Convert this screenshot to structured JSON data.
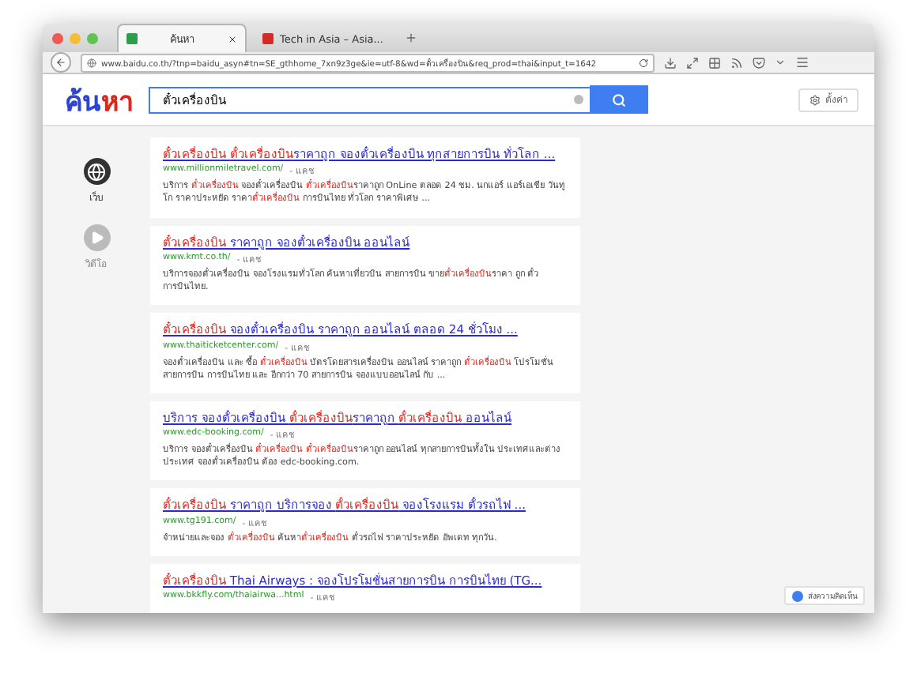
{
  "tabs": [
    {
      "label": "ค้นหา",
      "selected": true
    },
    {
      "label": "Tech in Asia – Asia...",
      "selected": false
    }
  ],
  "address": "www.baidu.co.th/?tnp=baidu_asyn#tn=SE_gthhome_7xn9z3ge&ie=utf-8&wd=ตั๋วเครื่องบิน&req_prod=thai&input_t=1642",
  "logo": [
    {
      "text": "ค้น",
      "color": "#2b44d6"
    },
    {
      "text": "หา",
      "color": "#e0261b"
    }
  ],
  "search": {
    "value": "ตั๋วเครื่องบิน"
  },
  "settings_button": "ตั้งค่า",
  "sidebar": {
    "items": [
      {
        "label": "เว็บ",
        "kind": "globe",
        "selected": true
      },
      {
        "label": "วิดีโอ",
        "kind": "video",
        "selected": false
      }
    ]
  },
  "results": [
    {
      "title": [
        {
          "text": "ตั๋วเครื่องบิน ",
          "highlight": true
        },
        {
          "text": "ตั๋วเครื่องบิน",
          "highlight": true
        },
        {
          "text": "ราคาถูก จองตั๋วเครื่องบิน ทุกสายการบิน ทั่วโลก ...",
          "highlight": false
        }
      ],
      "url": "www.millionmiletravel.com/",
      "cache": "- แคช",
      "snippet": [
        {
          "text": "บริการ ",
          "highlight": false
        },
        {
          "text": "ตั๋วเครื่องบิน",
          "highlight": true
        },
        {
          "text": " จองตั๋วเครื่องบิน ",
          "highlight": false
        },
        {
          "text": "ตั๋วเครื่องบิน",
          "highlight": true
        },
        {
          "text": "ราคาถูก OnLine ตลอด 24 ชม. นกแอร์ แอร์เอเชีย วันทูโก ราคาประหยัด ราคา",
          "highlight": false
        },
        {
          "text": "ตั๋วเครื่องบิน",
          "highlight": true
        },
        {
          "text": " การบินไทย ทั่วโลก ราคาพิเศษ ...",
          "highlight": false
        }
      ]
    },
    {
      "title": [
        {
          "text": "ตั๋วเครื่องบิน",
          "highlight": true
        },
        {
          "text": " ราคาถูก จองตั๋วเครื่องบิน ออนไลน์",
          "highlight": false
        }
      ],
      "url": "www.kmt.co.th/",
      "cache": "- แคช",
      "snippet": [
        {
          "text": "บริการจองตั๋วเครื่องบิน จองโรงแรมทั่วโลก ค้นหาเที่ยวบิน สายการบิน ขาย",
          "highlight": false
        },
        {
          "text": "ตั๋วเครื่องบิน",
          "highlight": true
        },
        {
          "text": "ราคา ถูก ตั๋วการบินไทย.",
          "highlight": false
        }
      ]
    },
    {
      "title": [
        {
          "text": "ตั๋วเครื่องบิน",
          "highlight": true
        },
        {
          "text": " จองตั๋วเครื่องบิน ราคาถูก ออนไลน์ ตลอด 24 ชั่วโมง ...",
          "highlight": false
        }
      ],
      "url": "www.thaiticketcenter.com/",
      "cache": "- แคช",
      "snippet": [
        {
          "text": "จองตั๋วเครื่องบิน และ ซื้อ ",
          "highlight": false
        },
        {
          "text": "ตั๋วเครื่องบิน",
          "highlight": true
        },
        {
          "text": " บัตรโดยสารเครื่องบิน ออนไลน์ ราคาถูก ",
          "highlight": false
        },
        {
          "text": "ตั๋วเครื่องบิน",
          "highlight": true
        },
        {
          "text": " โปรโมชั่น สายการบิน การบินไทย และ อีกกว่า 70 สายการบิน จองแบบออนไลน์ กับ ...",
          "highlight": false
        }
      ]
    },
    {
      "title": [
        {
          "text": "บริการ จองตั๋วเครื่องบิน ",
          "highlight": false
        },
        {
          "text": "ตั๋วเครื่องบิน",
          "highlight": true
        },
        {
          "text": "ราคาถูก ",
          "highlight": false
        },
        {
          "text": "ตั๋วเครื่องบิน",
          "highlight": true
        },
        {
          "text": " ออนไลน์",
          "highlight": false
        }
      ],
      "url": "www.edc-booking.com/",
      "cache": "- แคช",
      "snippet": [
        {
          "text": "บริการ จองตั๋วเครื่องบิน ",
          "highlight": false
        },
        {
          "text": "ตั๋วเครื่องบิน ",
          "highlight": true
        },
        {
          "text": "ตั๋วเครื่องบิน",
          "highlight": true
        },
        {
          "text": "ราคาถูก ออนไลน์ ทุกสายการบินทั้งใน ประเทศและต่างประเทศ จองตั๋วเครื่องบิน ต้อง edc-booking.com.",
          "highlight": false
        }
      ]
    },
    {
      "title": [
        {
          "text": "ตั๋วเครื่องบิน",
          "highlight": true
        },
        {
          "text": " ราคาถูก บริการจอง ",
          "highlight": false
        },
        {
          "text": "ตั๋วเครื่องบิน",
          "highlight": true
        },
        {
          "text": " จองโรงแรม ตั๋วรถไฟ ...",
          "highlight": false
        }
      ],
      "url": "www.tg191.com/",
      "cache": "- แคช",
      "snippet": [
        {
          "text": "จำหน่ายและจอง ",
          "highlight": false
        },
        {
          "text": "ตั๋วเครื่องบิน",
          "highlight": true
        },
        {
          "text": " ค้นหา",
          "highlight": false
        },
        {
          "text": "ตั๋วเครื่องบิน",
          "highlight": true
        },
        {
          "text": " ตั๋วรถไฟ ราคาประหยัด อัพเดท ทุกวัน.",
          "highlight": false
        }
      ]
    },
    {
      "title": [
        {
          "text": "ตั๋วเครื่องบิน",
          "highlight": true
        },
        {
          "text": " Thai Airways : จองโปรโมชั่นสายการบิน การบินไทย (TG...",
          "highlight": false
        }
      ],
      "url": "www.bkkfly.com/thaiairwa...html",
      "cache": "- แคช"
    }
  ],
  "feedback_button": "ส่งความคิดเห็น"
}
